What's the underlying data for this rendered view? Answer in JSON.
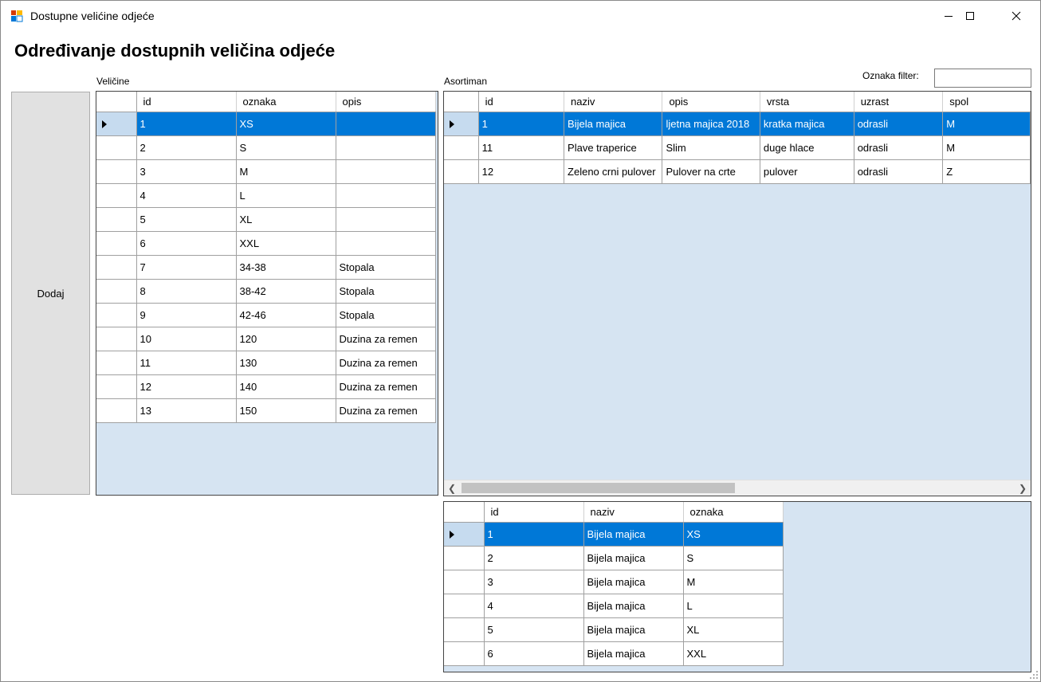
{
  "window": {
    "title": "Dostupne velićine odjeće"
  },
  "heading": "Određivanje dostupnih veličina odjeće",
  "sizes_group": {
    "label": "Veličine",
    "columns": [
      "id",
      "oznaka",
      "opis"
    ],
    "selected_row": 0,
    "rows": [
      [
        "1",
        "XS",
        ""
      ],
      [
        "2",
        "S",
        ""
      ],
      [
        "3",
        "M",
        ""
      ],
      [
        "4",
        "L",
        ""
      ],
      [
        "5",
        "XL",
        ""
      ],
      [
        "6",
        "XXL",
        ""
      ],
      [
        "7",
        "34-38",
        "Stopala"
      ],
      [
        "8",
        "38-42",
        "Stopala"
      ],
      [
        "9",
        "42-46",
        "Stopala"
      ],
      [
        "10",
        "120",
        "Duzina za remen"
      ],
      [
        "11",
        "130",
        "Duzina za remen"
      ],
      [
        "12",
        "140",
        "Duzina za remen"
      ],
      [
        "13",
        "150",
        "Duzina za remen"
      ]
    ]
  },
  "add_button": {
    "label": "Dodaj"
  },
  "assortment_group": {
    "label": "Asortiman",
    "filter_label": "Oznaka filter:",
    "filter_value": "",
    "columns": [
      "id",
      "naziv",
      "opis",
      "vrsta",
      "uzrast",
      "spol"
    ],
    "selected_row": 0,
    "rows": [
      [
        "1",
        "Bijela majica",
        "ljetna majica 2018",
        "kratka majica",
        "odrasli",
        "M"
      ],
      [
        "11",
        "Plave traperice",
        "Slim",
        "duge hlace",
        "odrasli",
        "M"
      ],
      [
        "12",
        "Zeleno crni pulover",
        "Pulover na crte",
        "pulover",
        "odrasli",
        "Z"
      ]
    ]
  },
  "detail_grid": {
    "columns": [
      "id",
      "naziv",
      "oznaka"
    ],
    "selected_row": 0,
    "rows": [
      [
        "1",
        "Bijela majica",
        "XS"
      ],
      [
        "2",
        "Bijela majica",
        "S"
      ],
      [
        "3",
        "Bijela majica",
        "M"
      ],
      [
        "4",
        "Bijela majica",
        "L"
      ],
      [
        "5",
        "Bijela majica",
        "XL"
      ],
      [
        "6",
        "Bijela majica",
        "XXL"
      ]
    ]
  },
  "colors": {
    "selection": "#0078d7",
    "grid_background": "#d6e4f2",
    "row_header_selected": "#c6dbef"
  }
}
